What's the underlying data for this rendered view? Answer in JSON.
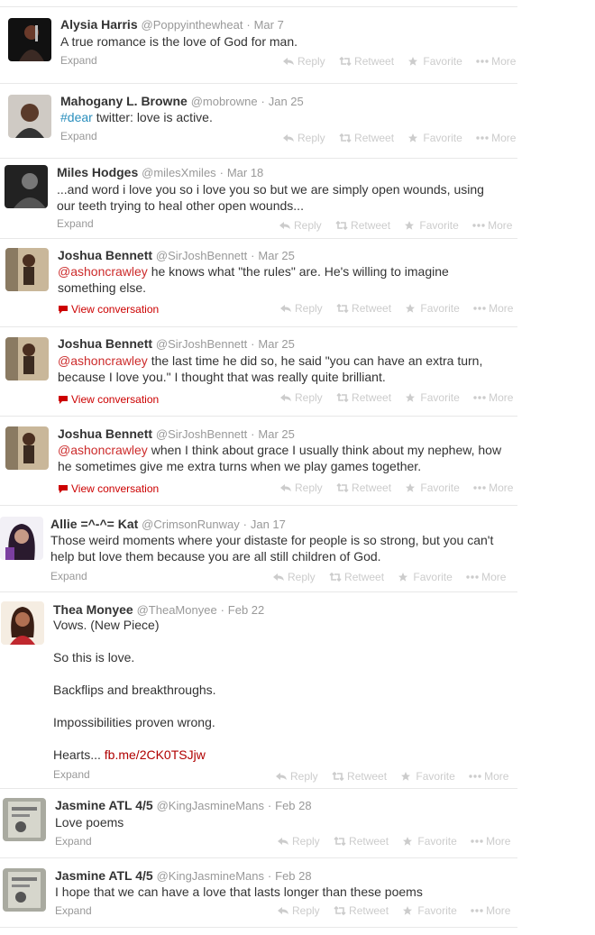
{
  "actions": {
    "reply": "Reply",
    "retweet": "Retweet",
    "favorite": "Favorite",
    "more": "More"
  },
  "labels": {
    "expand": "Expand",
    "view_conversation": "View conversation",
    "dot": "·"
  },
  "tweets": [
    {
      "name": "Alysia Harris",
      "handle": "@Poppyinthewheat",
      "time": "Mar 7",
      "text": "A true romance is the love of God for man."
    },
    {
      "name": "Mahogany L. Browne",
      "handle": "@mobrowne",
      "time": "Jan 25",
      "hashtag": "#dear",
      "text": " twitter: love is active."
    },
    {
      "name": "Miles Hodges",
      "handle": "@milesXmiles",
      "time": "Mar 18",
      "text": "...and word i love you so i love you so but we are simply open wounds, using our teeth trying to heal other open wounds..."
    },
    {
      "name": "Joshua Bennett",
      "handle": "@SirJoshBennett",
      "time": "Mar 25",
      "mention": "@ashoncrawley",
      "text": " he knows what \"the rules\" are. He's willing to imagine something else."
    },
    {
      "name": "Joshua Bennett",
      "handle": "@SirJoshBennett",
      "time": "Mar 25",
      "mention": "@ashoncrawley",
      "text": " the last time he did so, he said \"you can have an extra turn, because I love you.\" I thought that was really quite brilliant."
    },
    {
      "name": "Joshua Bennett",
      "handle": "@SirJoshBennett",
      "time": "Mar 25",
      "mention": "@ashoncrawley",
      "text": " when I think about grace I usually think about my nephew, how he sometimes give me extra turns when we play games together."
    },
    {
      "name": "Allie =^-^= Kat",
      "handle": "@CrimsonRunway",
      "time": "Jan 17",
      "text": "Those weird moments where your distaste for people is so strong, but you can't help but love them because you are all still children of God."
    },
    {
      "name": "Thea Monyee",
      "handle": "@TheaMonyee",
      "time": "Feb 22",
      "lines": [
        "Vows. (New Piece)",
        "So this is love.",
        "Backflips and breakthroughs.",
        "Impossibilities proven wrong.",
        "Hearts... "
      ],
      "link": "fb.me/2CK0TSJjw"
    },
    {
      "name": "Jasmine ATL 4/5",
      "handle": "@KingJasmineMans",
      "time": "Feb 28",
      "text": "Love poems"
    },
    {
      "name": "Jasmine ATL 4/5",
      "handle": "@KingJasmineMans",
      "time": "Feb 28",
      "text": "I hope that we can have a love that lasts longer than these poems"
    }
  ]
}
